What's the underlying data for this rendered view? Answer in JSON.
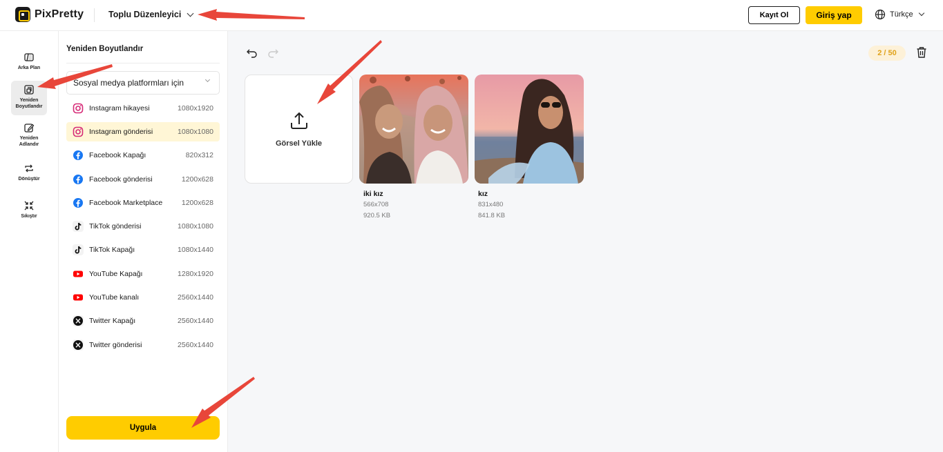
{
  "header": {
    "brand": "PixPretty",
    "tool_menu": "Toplu Düzenleyici",
    "signup": "Kayıt Ol",
    "login": "Giriş yap",
    "language": "Türkçe"
  },
  "rail": {
    "items": [
      {
        "label": "Arka Plan",
        "icon": "background-icon"
      },
      {
        "label": "Yeniden Boyutlandır",
        "icon": "resize-icon",
        "active": true
      },
      {
        "label": "Yeniden Adlandır",
        "icon": "rename-icon"
      },
      {
        "label": "Dönüştür",
        "icon": "convert-icon"
      },
      {
        "label": "Sıkıştır",
        "icon": "compress-icon"
      }
    ]
  },
  "panel": {
    "title": "Yeniden Boyutlandır",
    "select_value": "Sosyal medya platformları için",
    "presets": [
      {
        "name": "Instagram hikayesi",
        "size": "1080x1920",
        "icon": "instagram-icon"
      },
      {
        "name": "Instagram gönderisi",
        "size": "1080x1080",
        "icon": "instagram-icon",
        "selected": true
      },
      {
        "name": "Facebook Kapağı",
        "size": "820x312",
        "icon": "facebook-icon"
      },
      {
        "name": "Facebook gönderisi",
        "size": "1200x628",
        "icon": "facebook-icon"
      },
      {
        "name": "Facebook Marketplace",
        "size": "1200x628",
        "icon": "facebook-icon"
      },
      {
        "name": "TikTok gönderisi",
        "size": "1080x1080",
        "icon": "tiktok-icon"
      },
      {
        "name": "TikTok Kapağı",
        "size": "1080x1440",
        "icon": "tiktok-icon"
      },
      {
        "name": "YouTube Kapağı",
        "size": "1280x1920",
        "icon": "youtube-icon"
      },
      {
        "name": "YouTube kanalı",
        "size": "2560x1440",
        "icon": "youtube-icon"
      },
      {
        "name": "Twitter Kapağı",
        "size": "2560x1440",
        "icon": "x-icon"
      },
      {
        "name": "Twitter gönderisi",
        "size": "2560x1440",
        "icon": "x-icon"
      }
    ],
    "apply": "Uygula"
  },
  "main": {
    "counter": "2 / 50",
    "upload_label": "Görsel Yükle",
    "images": [
      {
        "name": "iki kız",
        "dims": "566x708",
        "size": "920.5 KB"
      },
      {
        "name": "kız",
        "dims": "831x480",
        "size": "841.8 KB"
      }
    ]
  },
  "colors": {
    "accent": "#ffcc00",
    "selected_bg": "#fff6d6",
    "counter_text": "#e0a21a",
    "annotation_arrow": "#e8463a"
  }
}
